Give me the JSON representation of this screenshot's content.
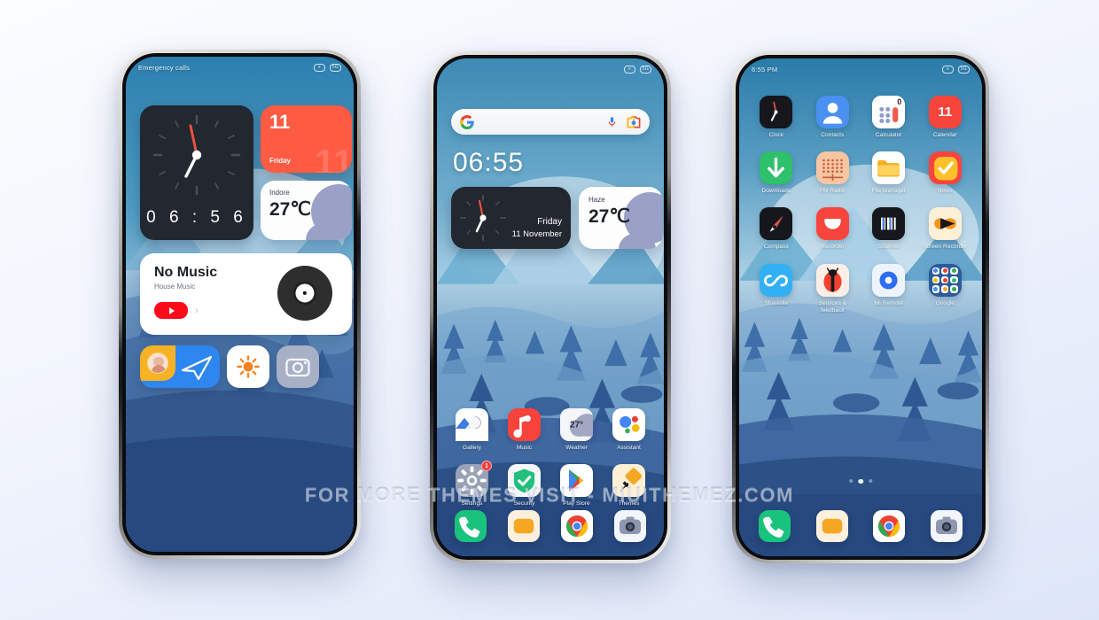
{
  "page": {
    "watermark": "FOR MORE THEMES VISIT - MIUITHEMEZ.COM",
    "background_color": "#eef2fc",
    "accent_colors": {
      "calendar_red": "#ff5a42",
      "music_red": "#ff0a18",
      "dock_green": "#19c37d",
      "wallpaper_blue": "#27497f"
    }
  },
  "phone1": {
    "status": {
      "carrier": "Emergency calls",
      "icon_left": "mute-icon",
      "icon_right": "data-saver-icon",
      "chip1": "x",
      "chip2": "5G"
    },
    "clock_widget": {
      "name": "analog-clock-widget",
      "digital_time": "0 6 : 5 6",
      "hour_angle": 205,
      "minute_angle": 336
    },
    "calendar_widget": {
      "date_number": "11",
      "weekday": "Friday",
      "ghost_number": "11"
    },
    "weather_widget": {
      "city": "Indore",
      "temperature": "27℃"
    },
    "music_widget": {
      "title": "No Music",
      "subtitle": "House Music",
      "player": "youtube-music",
      "chevron": "›"
    },
    "shortcuts": [
      {
        "name": "telegram-shortcut",
        "label": "Telegram"
      },
      {
        "name": "brightness-shortcut",
        "label": "Brightness"
      },
      {
        "name": "camera-shortcut",
        "label": "Camera"
      }
    ]
  },
  "phone2": {
    "status": {
      "carrier": "",
      "chip1": "x",
      "chip2": "5G"
    },
    "search": {
      "placeholder": "",
      "logo": "google-g-icon",
      "mic": "mic-icon",
      "lens": "google-lens-icon"
    },
    "clock_text": "06:55",
    "clock_widget": {
      "weekday": "Friday",
      "date": "11 November",
      "hour_angle": 205,
      "minute_angle": 336
    },
    "weather_widget": {
      "condition": "Haze",
      "temperature": "27℃"
    },
    "apps": [
      {
        "label": "Gallery",
        "icon": "gallery-icon"
      },
      {
        "label": "Music",
        "icon": "music-note-icon"
      },
      {
        "label": "Weather",
        "icon": "weather-icon",
        "value": "27°"
      },
      {
        "label": "Assistant",
        "icon": "google-assistant-icon"
      },
      {
        "label": "Settings",
        "icon": "gear-icon",
        "badge": "1"
      },
      {
        "label": "Security",
        "icon": "shield-check-icon"
      },
      {
        "label": "Play Store",
        "icon": "play-store-icon"
      },
      {
        "label": "Themes",
        "icon": "themes-brush-icon"
      }
    ],
    "dock": [
      {
        "label": "Phone",
        "icon": "phone-icon"
      },
      {
        "label": "Messages",
        "icon": "messages-icon"
      },
      {
        "label": "Chrome",
        "icon": "chrome-icon"
      },
      {
        "label": "Camera",
        "icon": "camera-icon"
      }
    ]
  },
  "phone3": {
    "status": {
      "time": "6:55 PM",
      "chip1": "x",
      "chip2": "5G"
    },
    "apps": [
      {
        "label": "Clock",
        "icon": "clock-icon"
      },
      {
        "label": "Contacts",
        "icon": "contacts-icon"
      },
      {
        "label": "Calculator",
        "icon": "calculator-icon",
        "value": "0"
      },
      {
        "label": "Calendar",
        "icon": "calendar-icon",
        "value": "11"
      },
      {
        "label": "Downloads",
        "icon": "download-arrow-icon"
      },
      {
        "label": "FM Radio",
        "icon": "fm-radio-icon"
      },
      {
        "label": "File Manager",
        "icon": "folder-icon"
      },
      {
        "label": "Notes",
        "icon": "notes-check-icon"
      },
      {
        "label": "Compass",
        "icon": "compass-icon"
      },
      {
        "label": "Recorder",
        "icon": "recorder-icon"
      },
      {
        "label": "Scanner",
        "icon": "barcode-scanner-icon"
      },
      {
        "label": "Screen Recorder",
        "icon": "screen-recorder-icon"
      },
      {
        "label": "ShareMe",
        "icon": "shareme-infinity-icon"
      },
      {
        "label": "Services & feedback",
        "icon": "ladybug-icon"
      },
      {
        "label": "Mi Remote",
        "icon": "mi-remote-icon"
      },
      {
        "label": "Google",
        "icon": "google-folder-icon"
      }
    ],
    "page_dots": {
      "count": 3,
      "active_index": 1
    },
    "dock": [
      {
        "label": "Phone",
        "icon": "phone-icon"
      },
      {
        "label": "Messages",
        "icon": "messages-icon"
      },
      {
        "label": "Chrome",
        "icon": "chrome-icon"
      },
      {
        "label": "Camera",
        "icon": "camera-icon"
      }
    ]
  }
}
